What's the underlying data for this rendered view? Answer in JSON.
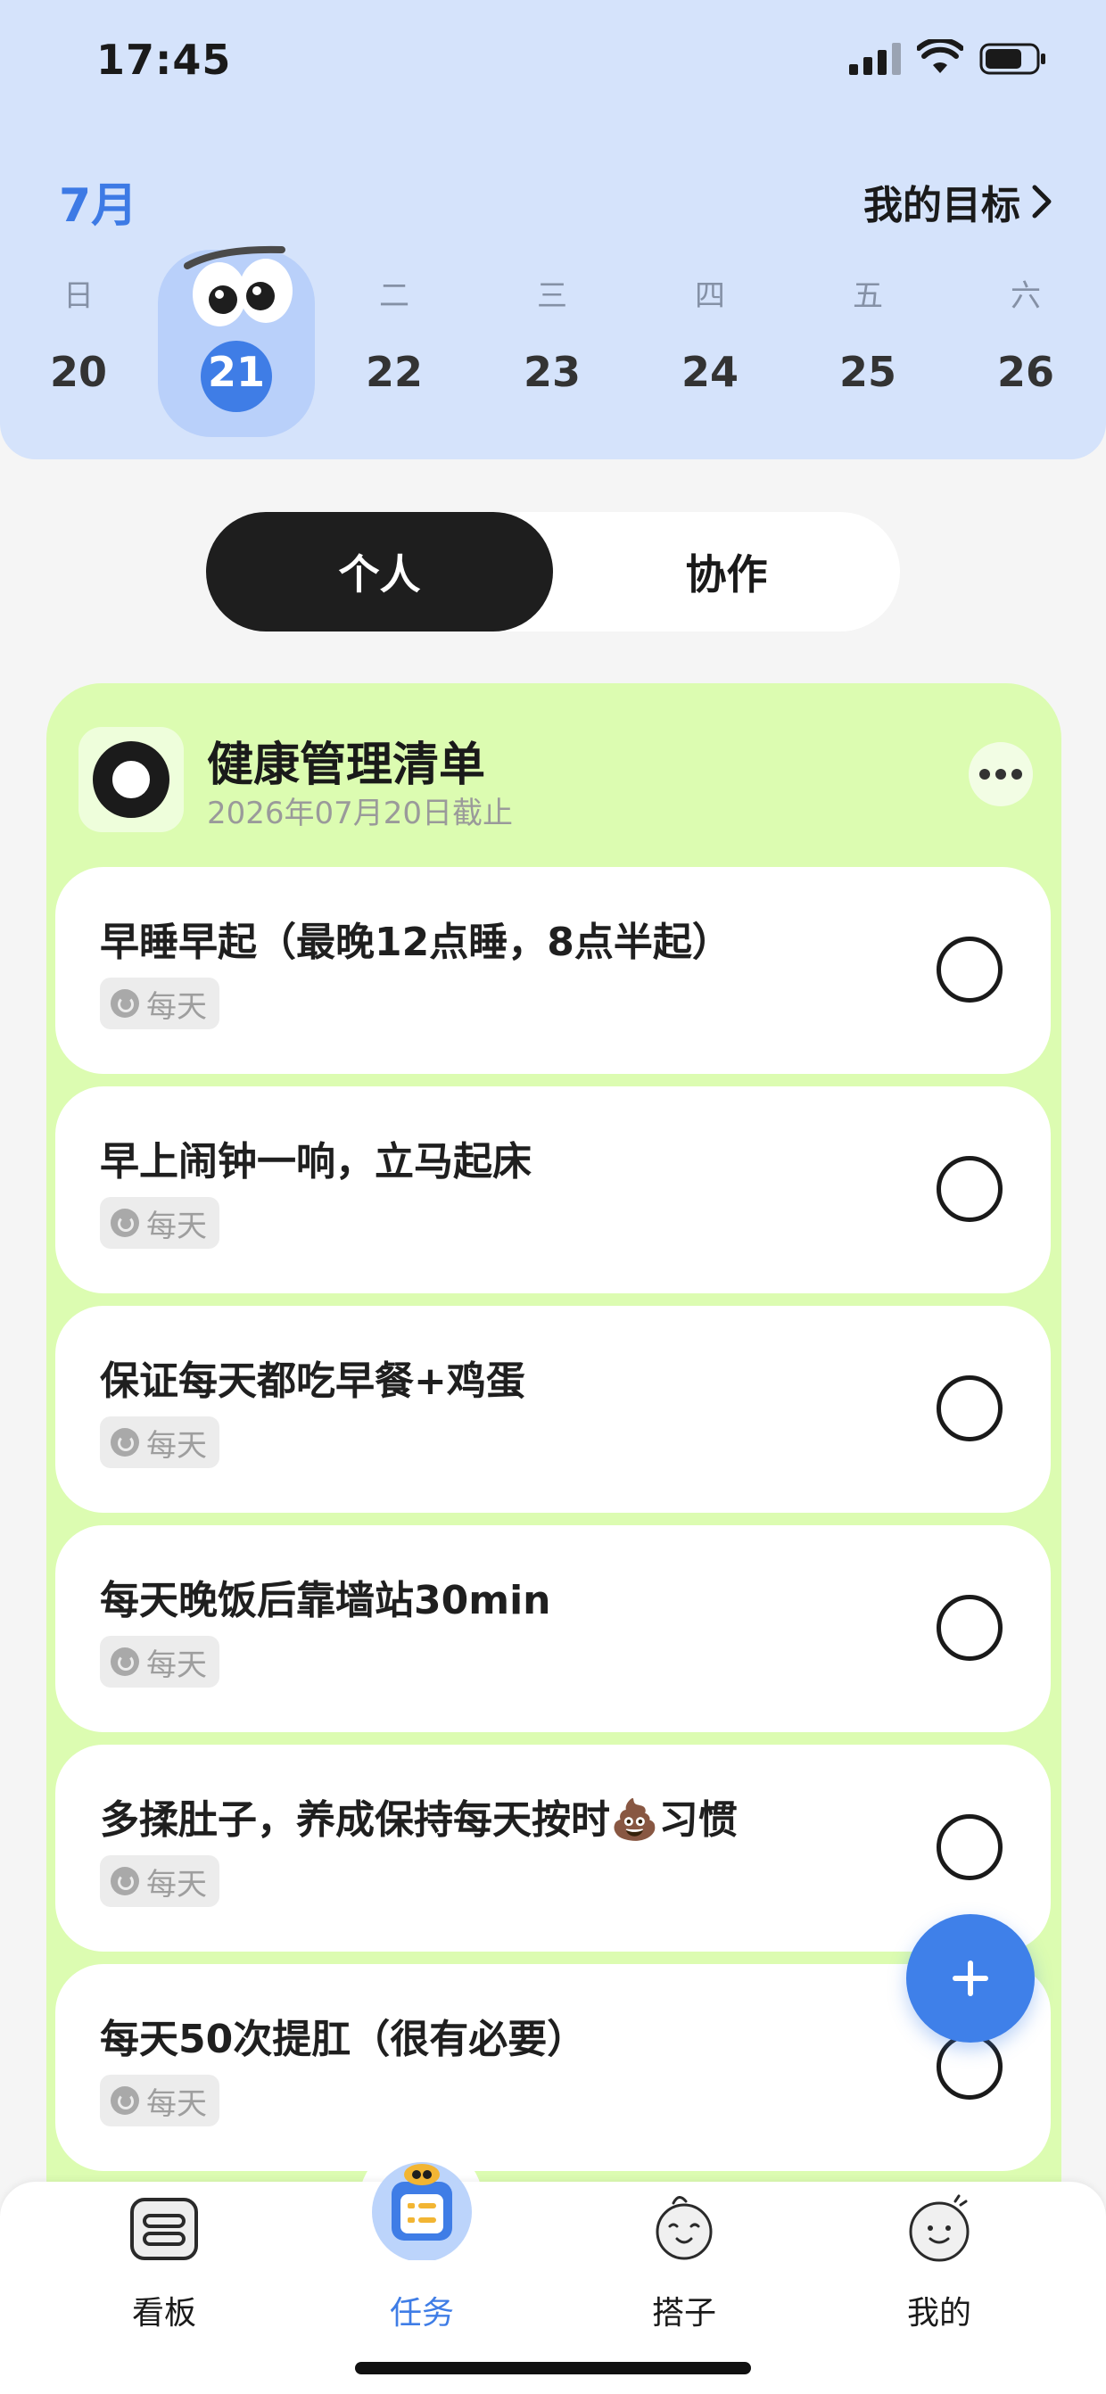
{
  "status_bar": {
    "time": "17:45"
  },
  "calendar": {
    "month": "7月",
    "goal_link": "我的目标",
    "week": [
      {
        "weekday": "日",
        "date": "20"
      },
      {
        "weekday": "",
        "date": "21",
        "selected": true
      },
      {
        "weekday": "二",
        "date": "22"
      },
      {
        "weekday": "三",
        "date": "23"
      },
      {
        "weekday": "四",
        "date": "24"
      },
      {
        "weekday": "五",
        "date": "25"
      },
      {
        "weekday": "六",
        "date": "26"
      }
    ]
  },
  "segment": {
    "personal": "个人",
    "collab": "协作",
    "active": "personal"
  },
  "list": {
    "title": "健康管理清单",
    "deadline": "2026年07月20日截止",
    "tasks": [
      {
        "title": "早睡早起（最晚12点睡，8点半起）",
        "repeat": "每天"
      },
      {
        "title": "早上闹钟一响，立马起床",
        "repeat": "每天"
      },
      {
        "title": "保证每天都吃早餐+鸡蛋",
        "repeat": "每天"
      },
      {
        "title": "每天晚饭后靠墙站30min",
        "repeat": "每天"
      },
      {
        "title": "多揉肚子，养成保持每天按时💩习惯",
        "repeat": "每天"
      },
      {
        "title": "每天50次提肛（很有必要）",
        "repeat": "每天"
      }
    ]
  },
  "tabs": [
    {
      "label": "看板",
      "icon": "board-icon"
    },
    {
      "label": "任务",
      "icon": "tasks-icon",
      "active": true
    },
    {
      "label": "搭子",
      "icon": "buddy-icon"
    },
    {
      "label": "我的",
      "icon": "profile-icon"
    }
  ],
  "colors": {
    "accent": "#3f7de6",
    "header_bg": "#d5e3fb",
    "card_bg": "#dcfcb1"
  }
}
